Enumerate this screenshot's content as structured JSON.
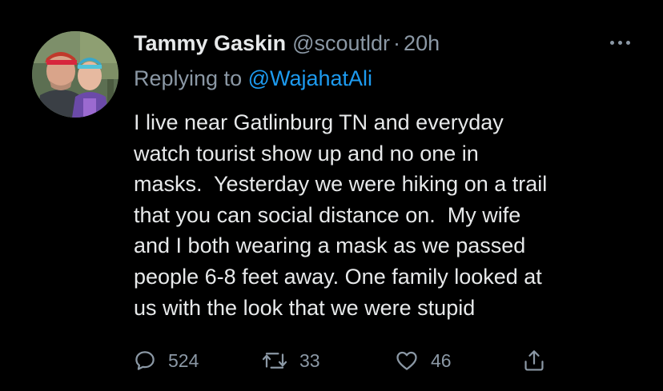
{
  "tweet": {
    "author": {
      "display_name": "Tammy Gaskin",
      "handle": "@scoutldr",
      "avatar_icon": "profile-photo"
    },
    "separator": "·",
    "timestamp": "20h",
    "reply": {
      "prefix": "Replying to ",
      "mention": "@WajahatAli"
    },
    "text": "I live near Gatlinburg TN and everyday\nwatch tourist show up and no one in\nmasks.  Yesterday we were hiking on a trail\nthat you can social distance on.  My wife\nand I both wearing a mask as we passed\npeople 6-8 feet away. One family looked at\nus with the look that we were stupid",
    "metrics": {
      "replies": "524",
      "retweets": "33",
      "likes": "46"
    },
    "icons": {
      "reply": "speech-bubble-icon",
      "retweet": "retweet-icon",
      "like": "heart-icon",
      "share": "share-icon",
      "more": "more-dots-icon"
    }
  },
  "colors": {
    "background": "#000000",
    "primary_text": "#e7e9ea",
    "secondary_text": "#8b98a5",
    "link": "#1d9bf0"
  }
}
